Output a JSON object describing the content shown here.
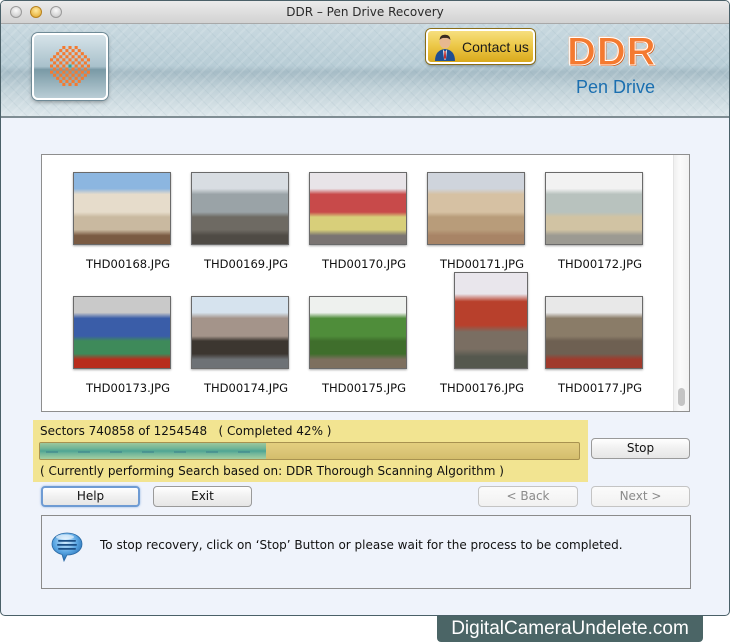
{
  "window": {
    "title": "DDR – Pen Drive Recovery"
  },
  "banner": {
    "contact_label": "Contact us",
    "brand": "DDR",
    "product": "Pen Drive",
    "accent_color": "#f47a30",
    "product_color": "#1b6fb0"
  },
  "gallery": {
    "files": [
      {
        "name": "THD00168.JPG",
        "scene": "bridge",
        "orientation": "landscape"
      },
      {
        "name": "THD00169.JPG",
        "scene": "riverside",
        "orientation": "landscape"
      },
      {
        "name": "THD00170.JPG",
        "scene": "storefront",
        "orientation": "landscape"
      },
      {
        "name": "THD00171.JPG",
        "scene": "fort-gate",
        "orientation": "landscape"
      },
      {
        "name": "THD00172.JPG",
        "scene": "railway-station",
        "orientation": "landscape"
      },
      {
        "name": "THD00173.JPG",
        "scene": "exhibition-hall",
        "orientation": "landscape"
      },
      {
        "name": "THD00174.JPG",
        "scene": "street",
        "orientation": "landscape"
      },
      {
        "name": "THD00175.JPG",
        "scene": "hill-path",
        "orientation": "landscape"
      },
      {
        "name": "THD00176.JPG",
        "scene": "tower",
        "orientation": "portrait"
      },
      {
        "name": "THD00177.JPG",
        "scene": "building",
        "orientation": "landscape"
      }
    ]
  },
  "progress": {
    "sectors_text": "Sectors 740858 of 1254548   ( Completed 42% )",
    "sectors_done": 740858,
    "sectors_total": 1254548,
    "percent": 42,
    "status_text": "( Currently performing Search based on: DDR Thorough Scanning Algorithm )"
  },
  "buttons": {
    "stop": "Stop",
    "help": "Help",
    "exit": "Exit",
    "back": "< Back",
    "next": "Next >"
  },
  "info": {
    "message": "To stop recovery, click on ‘Stop’ Button or please wait for the process to be completed."
  },
  "watermark": "DigitalCameraUndelete.com"
}
